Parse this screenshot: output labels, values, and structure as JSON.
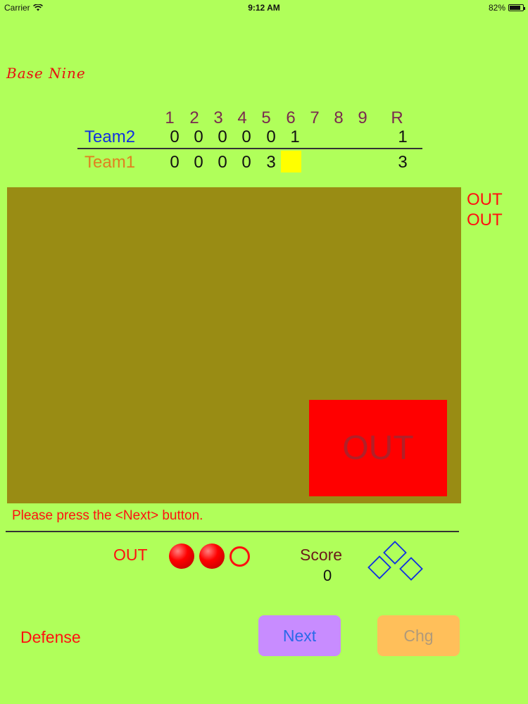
{
  "status_bar": {
    "carrier": "Carrier",
    "time": "9:12 AM",
    "battery": "82%",
    "battery_level": 0.82
  },
  "app_title": "Base Nine",
  "scoreboard": {
    "innings": [
      "1",
      "2",
      "3",
      "4",
      "5",
      "6",
      "7",
      "8",
      "9"
    ],
    "runs_header": "R",
    "teams": [
      {
        "name": "Team2",
        "color": "#1030e0",
        "scores": [
          "0",
          "0",
          "0",
          "0",
          "0",
          "1",
          "",
          "",
          ""
        ],
        "runs": "1"
      },
      {
        "name": "Team1",
        "color": "#e08020",
        "scores": [
          "0",
          "0",
          "0",
          "0",
          "3",
          "",
          "",
          "",
          ""
        ],
        "runs": "3"
      }
    ],
    "current_inning_highlight": "#ffff00"
  },
  "field": {
    "result_box_text": "OUT",
    "side_results": [
      "OUT",
      "OUT"
    ]
  },
  "message": "Please press the <Next> button.",
  "status": {
    "out_label": "OUT",
    "outs": 2,
    "max_outs": 3,
    "score_label": "Score",
    "score_value": "0"
  },
  "bases_icon": "bases-diamond-icon",
  "buttons": {
    "next": "Next",
    "chg": "Chg"
  },
  "mode_label": "Defense"
}
